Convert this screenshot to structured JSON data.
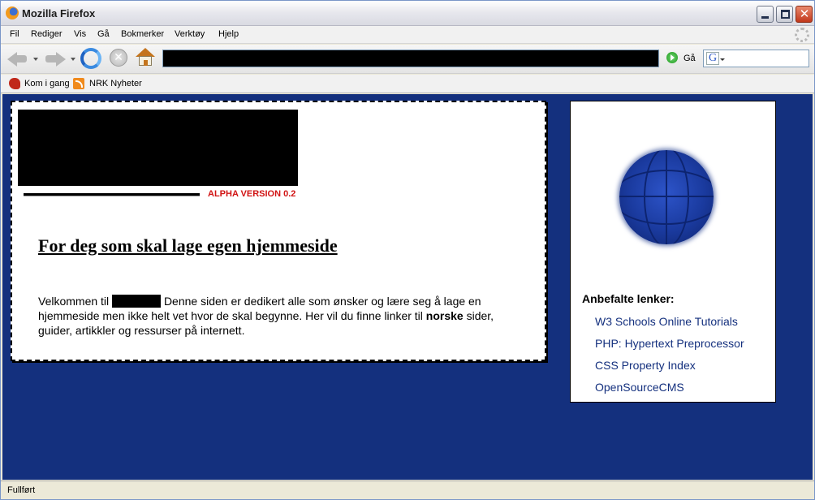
{
  "window": {
    "title": "Mozilla Firefox"
  },
  "menubar": {
    "items": [
      "Fil",
      "Rediger",
      "Vis",
      "Gå",
      "Bokmerker",
      "Verktøy",
      "Hjelp"
    ]
  },
  "navbar": {
    "go_label": "Gå"
  },
  "bookmarks": {
    "items": [
      "Kom i gang",
      "NRK Nyheter"
    ]
  },
  "page": {
    "version_label": "ALPHA VERSION 0.2",
    "heading": "For deg som skal lage egen hjemmeside",
    "intro_before": "Velkommen til",
    "intro_middle": "Denne siden er dedikert alle som ønsker og lære seg å lage en hjemmeside men ikke helt vet hvor de skal begynne. Her vil du finne linker til",
    "intro_bold": "norske",
    "intro_after": "sider, guider, artikkler og ressurser på internett."
  },
  "sidebar": {
    "links_heading": "Anbefalte lenker:",
    "links": [
      "W3 Schools Online Tutorials",
      "PHP: Hypertext Preprocessor",
      "CSS Property Index",
      "OpenSourceCMS"
    ]
  },
  "status": {
    "text": "Fullført"
  },
  "colors": {
    "page_background": "#14307e",
    "version_text": "#d11414",
    "link_text": "#14307e"
  }
}
